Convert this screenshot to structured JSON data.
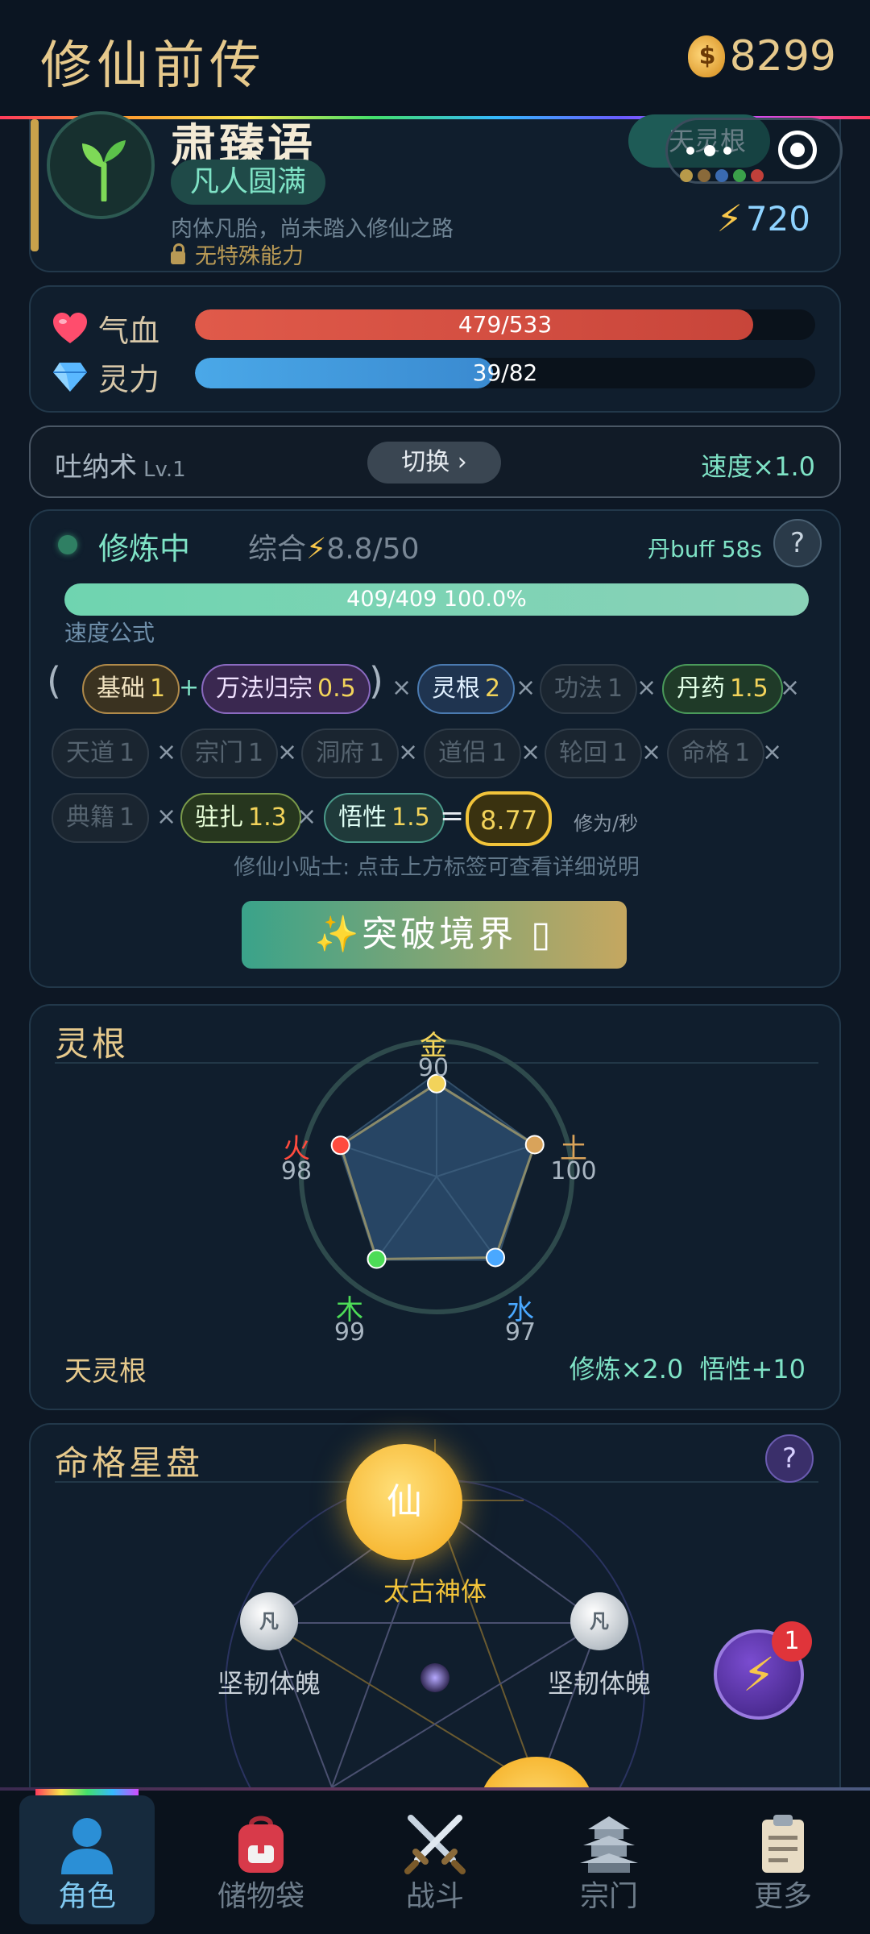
{
  "header": {
    "title": "修仙前传",
    "coins": "8299"
  },
  "profile": {
    "name": "肃臻语",
    "realm": "凡人圆满",
    "description": "肉体凡胎，尚未踏入修仙之路",
    "ability": "无特殊能力",
    "root_tag": "天灵根",
    "energy": "720"
  },
  "stats": {
    "hp": {
      "label": "气血",
      "text": "479/533",
      "fill": 0.9
    },
    "mp": {
      "label": "灵力",
      "text": "39/82",
      "fill": 0.48
    }
  },
  "technique": {
    "name": "吐纳术",
    "level": "Lv.1",
    "switch_label": "切换 ›",
    "speed": "速度×1.0"
  },
  "cultivation": {
    "status": "修炼中",
    "composite_label": "综合",
    "composite_value": "8.8/50",
    "pill_buff": "丹buff 58s",
    "help": "?",
    "progress_text": "409/409  100.0%",
    "progress_fill": 1.0,
    "formula_label": "速度公式",
    "chips": [
      {
        "label": "基础",
        "value": "1"
      },
      {
        "label": "万法归宗",
        "value": "0.5"
      },
      {
        "label": "灵根",
        "value": "2"
      },
      {
        "label": "功法",
        "value": "1"
      },
      {
        "label": "丹药",
        "value": "1.5"
      },
      {
        "label": "天道",
        "value": "1"
      },
      {
        "label": "宗门",
        "value": "1"
      },
      {
        "label": "洞府",
        "value": "1"
      },
      {
        "label": "道侣",
        "value": "1"
      },
      {
        "label": "轮回",
        "value": "1"
      },
      {
        "label": "命格",
        "value": "1"
      },
      {
        "label": "典籍",
        "value": "1"
      },
      {
        "label": "驻扎",
        "value": "1.3"
      },
      {
        "label": "悟性",
        "value": "1.5"
      }
    ],
    "result": "8.77",
    "result_unit": "修为/秒",
    "tip": "修仙小贴士: 点击上方标签可查看详细说明",
    "breakthrough_label": "✨突破境界 ▯"
  },
  "spirit_root": {
    "title": "灵根",
    "elements": [
      {
        "name": "金",
        "value": 90,
        "color": "#f2d35a"
      },
      {
        "name": "土",
        "value": 100,
        "color": "#d9a35a"
      },
      {
        "name": "水",
        "value": 97,
        "color": "#4aa8ff"
      },
      {
        "name": "木",
        "value": 99,
        "color": "#4ddc57"
      },
      {
        "name": "火",
        "value": 98,
        "color": "#ff4b3e"
      }
    ],
    "root_name": "天灵根",
    "bonus": "修炼×2.0  悟性+10"
  },
  "fate": {
    "title": "命格星盘",
    "help": "?",
    "main_star": {
      "glyph": "仙",
      "label": "太古神体"
    },
    "left_star": {
      "glyph": "凡",
      "label": "坚韧体魄"
    },
    "right_star": {
      "glyph": "凡",
      "label": "坚韧体魄"
    },
    "fab_badge": "1"
  },
  "nav": [
    {
      "label": "角色",
      "icon": "person-icon"
    },
    {
      "label": "储物袋",
      "icon": "backpack-icon"
    },
    {
      "label": "战斗",
      "icon": "crossed-swords-icon"
    },
    {
      "label": "宗门",
      "icon": "pagoda-icon"
    },
    {
      "label": "更多",
      "icon": "clipboard-icon"
    }
  ]
}
